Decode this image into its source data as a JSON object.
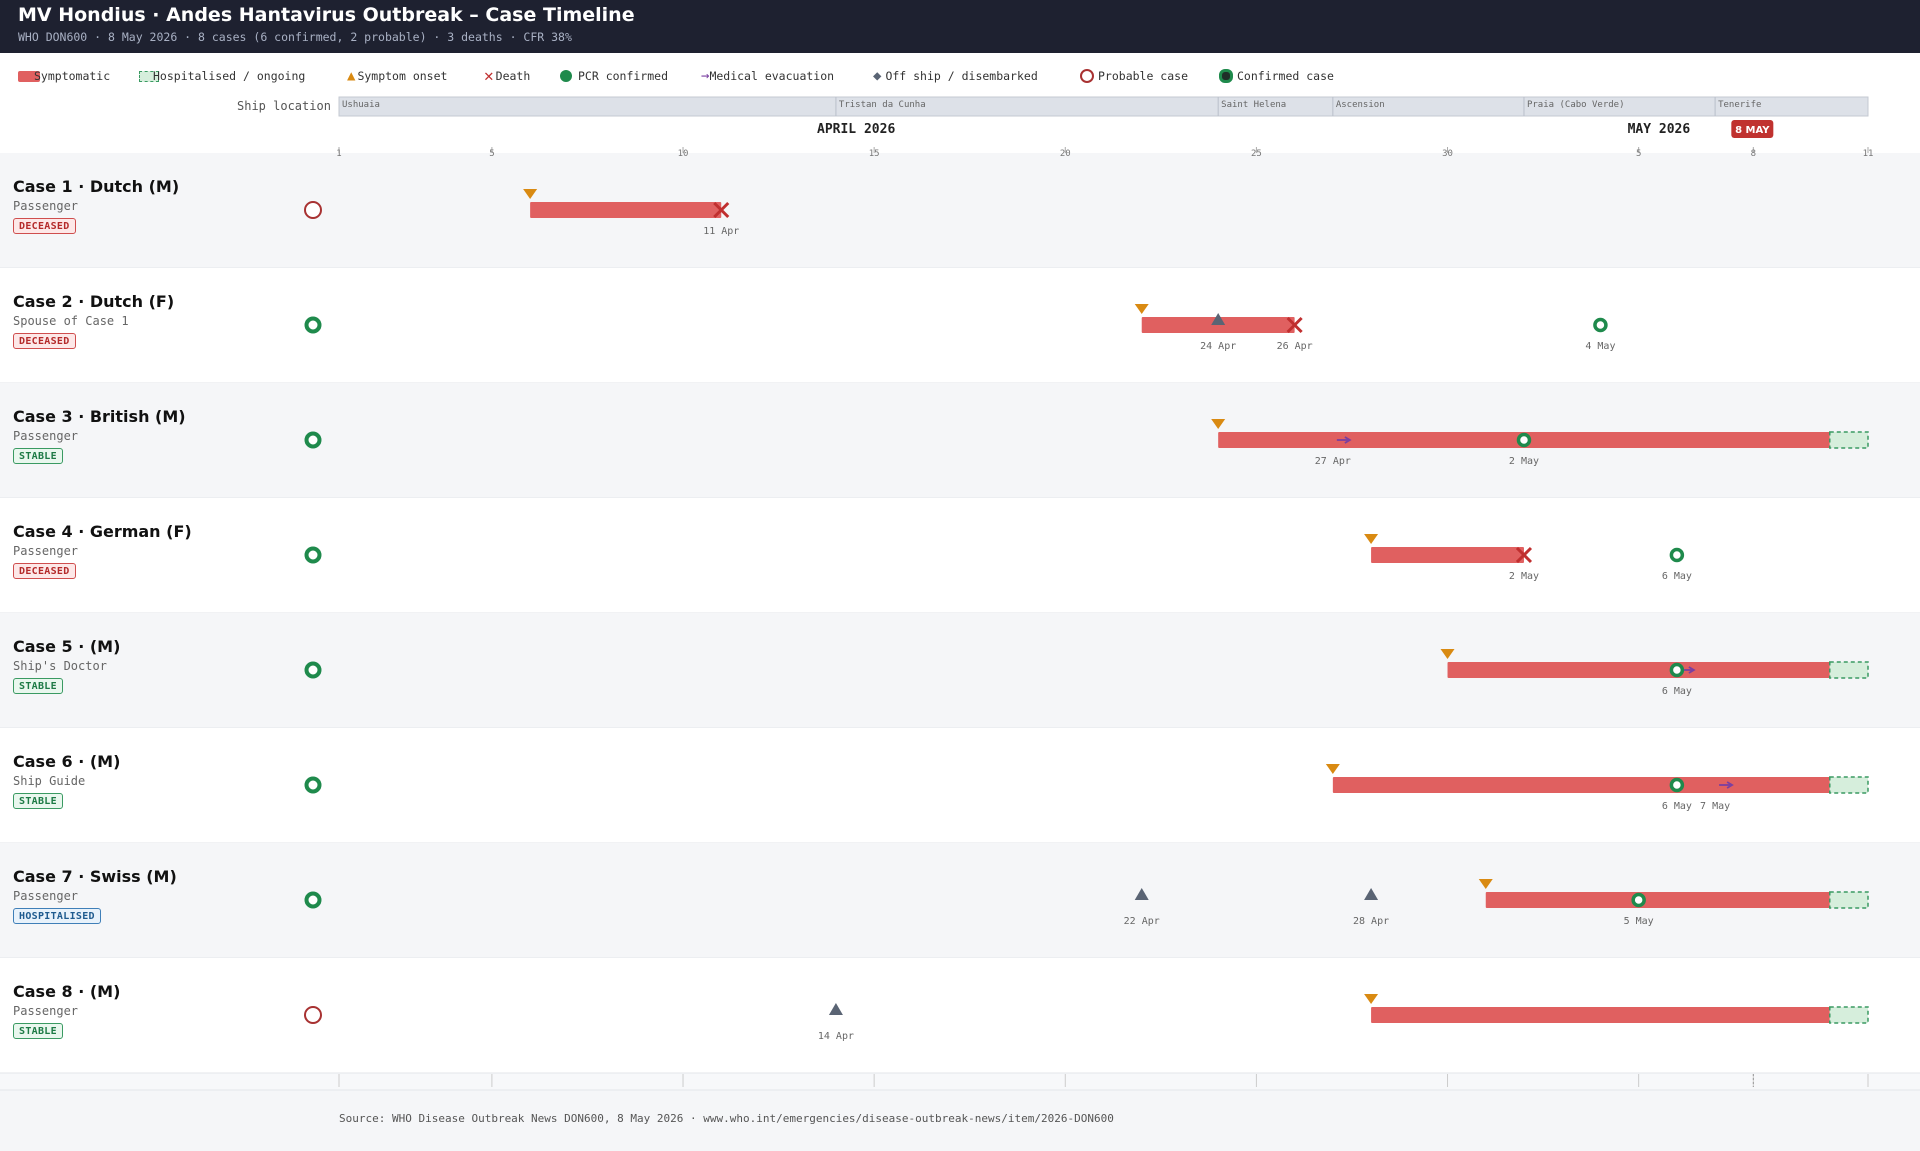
{
  "header": {
    "title": "MV Hondius · Andes Hantavirus Outbreak – Case Timeline",
    "subtitle": "WHO DON600 · 8 May 2026 · 8 cases (6 confirmed, 2 probable) · 3 deaths · CFR 38%"
  },
  "legend": [
    {
      "key": "symptomatic",
      "label": "Symptomatic",
      "color": "#e06060"
    },
    {
      "key": "hospitalised",
      "label": "Hospitalised / ongoing",
      "color": "#d6eedc"
    },
    {
      "key": "onset",
      "label": "Symptom onset",
      "color": "#d98a12"
    },
    {
      "key": "death",
      "label": "Death",
      "color": "#c02f2f"
    },
    {
      "key": "pcr",
      "label": "PCR confirmed",
      "color": "#1f8a4c"
    },
    {
      "key": "medevac",
      "label": "Medical evacuation",
      "color": "#7a3fa0"
    },
    {
      "key": "offship",
      "label": "Off ship / disembarked",
      "color": "#5a6474"
    },
    {
      "key": "probable",
      "label": "Probable case",
      "color": "#a83232"
    },
    {
      "key": "confirmed",
      "label": "Confirmed case",
      "color": "#1f8a4c"
    }
  ],
  "ship_location_label": "Ship location",
  "ship_locations": [
    {
      "name": "Ushuaia",
      "start": "2026-04-01"
    },
    {
      "name": "Tristan da Cunha",
      "start": "2026-04-14"
    },
    {
      "name": "Saint Helena",
      "start": "2026-04-24"
    },
    {
      "name": "Ascension",
      "start": "2026-04-27"
    },
    {
      "name": "Praia (Cabo Verde)",
      "start": "2026-05-02"
    },
    {
      "name": "Tenerife",
      "start": "2026-05-07"
    }
  ],
  "month_labels": [
    {
      "label": "APRIL 2026",
      "date": "2026-04-15"
    },
    {
      "label": "MAY 2026",
      "date": "2026-05-06"
    }
  ],
  "today_label": "8 MAY",
  "source": "Source: WHO Disease Outbreak News DON600, 8 May 2026 · www.who.int/emergencies/disease-outbreak-news/item/2026-DON600",
  "chart_data": {
    "type": "timeline",
    "x_range": [
      "2026-04-01",
      "2026-05-11"
    ],
    "ticks": [
      {
        "date": "2026-04-01",
        "label": "1"
      },
      {
        "date": "2026-04-05",
        "label": "5"
      },
      {
        "date": "2026-04-10",
        "label": "10"
      },
      {
        "date": "2026-04-15",
        "label": "15"
      },
      {
        "date": "2026-04-20",
        "label": "20"
      },
      {
        "date": "2026-04-25",
        "label": "25"
      },
      {
        "date": "2026-04-30",
        "label": "30"
      },
      {
        "date": "2026-05-05",
        "label": "5"
      },
      {
        "date": "2026-05-08",
        "label": "8"
      },
      {
        "date": "2026-05-11",
        "label": "11"
      }
    ],
    "today": "2026-05-08",
    "cases": [
      {
        "title": "Case 1 · Dutch (M)",
        "role": "Passenger",
        "status": "DECEASED",
        "classification": "probable",
        "symptomatic": [
          "2026-04-06",
          "2026-04-11"
        ],
        "ongoing": false,
        "onset": "2026-04-06",
        "death": "2026-04-11",
        "pcr": null,
        "offship": [],
        "medevac": [],
        "labels": [
          {
            "date": "2026-04-11",
            "text": "11 Apr"
          }
        ]
      },
      {
        "title": "Case 2 · Dutch (F)",
        "role": "Spouse of Case 1",
        "status": "DECEASED",
        "classification": "confirmed",
        "symptomatic": [
          "2026-04-22",
          "2026-04-26"
        ],
        "ongoing": false,
        "onset": "2026-04-22",
        "death": "2026-04-26",
        "pcr": "2026-05-04",
        "offship": [
          "2026-04-24"
        ],
        "medevac": [],
        "labels": [
          {
            "date": "2026-04-24",
            "text": "24 Apr"
          },
          {
            "date": "2026-04-26",
            "text": "26 Apr"
          },
          {
            "date": "2026-05-04",
            "text": "4 May"
          }
        ]
      },
      {
        "title": "Case 3 · British (M)",
        "role": "Passenger",
        "status": "STABLE",
        "classification": "confirmed",
        "symptomatic": [
          "2026-04-24",
          "2026-05-10"
        ],
        "ongoing": true,
        "onset": "2026-04-24",
        "death": null,
        "pcr": "2026-05-02",
        "offship": [],
        "medevac": [
          "2026-04-27"
        ],
        "labels": [
          {
            "date": "2026-04-27",
            "text": "27 Apr"
          },
          {
            "date": "2026-05-02",
            "text": "2 May"
          }
        ]
      },
      {
        "title": "Case 4 · German (F)",
        "role": "Passenger",
        "status": "DECEASED",
        "classification": "confirmed",
        "symptomatic": [
          "2026-04-28",
          "2026-05-02"
        ],
        "ongoing": false,
        "onset": "2026-04-28",
        "death": "2026-05-02",
        "pcr": "2026-05-06",
        "offship": [],
        "medevac": [],
        "labels": [
          {
            "date": "2026-05-02",
            "text": "2 May"
          },
          {
            "date": "2026-05-06",
            "text": "6 May"
          }
        ]
      },
      {
        "title": "Case 5 · (M)",
        "role": "Ship's Doctor",
        "status": "STABLE",
        "classification": "confirmed",
        "symptomatic": [
          "2026-04-30",
          "2026-05-10"
        ],
        "ongoing": true,
        "onset": "2026-04-30",
        "death": null,
        "pcr": "2026-05-06",
        "offship": [],
        "medevac": [
          "2026-05-06"
        ],
        "labels": [
          {
            "date": "2026-05-06",
            "text": "6 May"
          }
        ]
      },
      {
        "title": "Case 6 · (M)",
        "role": "Ship Guide",
        "status": "STABLE",
        "classification": "confirmed",
        "symptomatic": [
          "2026-04-27",
          "2026-05-10"
        ],
        "ongoing": true,
        "onset": "2026-04-27",
        "death": null,
        "pcr": "2026-05-06",
        "offship": [],
        "medevac": [
          "2026-05-07"
        ],
        "labels": [
          {
            "date": "2026-05-06",
            "text": "6 May"
          },
          {
            "date": "2026-05-07",
            "text": "7 May"
          }
        ]
      },
      {
        "title": "Case 7 · Swiss (M)",
        "role": "Passenger",
        "status": "HOSPITALISED",
        "classification": "confirmed",
        "symptomatic": [
          "2026-05-01",
          "2026-05-10"
        ],
        "ongoing": true,
        "onset": "2026-05-01",
        "death": null,
        "pcr": "2026-05-05",
        "offship": [
          "2026-04-22",
          "2026-04-28"
        ],
        "medevac": [],
        "labels": [
          {
            "date": "2026-04-22",
            "text": "22 Apr"
          },
          {
            "date": "2026-04-28",
            "text": "28 Apr"
          },
          {
            "date": "2026-05-05",
            "text": "5 May"
          }
        ]
      },
      {
        "title": "Case 8 · (M)",
        "role": "Passenger",
        "status": "STABLE",
        "classification": "probable",
        "symptomatic": [
          "2026-04-28",
          "2026-05-10"
        ],
        "ongoing": true,
        "onset": "2026-04-28",
        "death": null,
        "pcr": null,
        "offship": [
          "2026-04-14"
        ],
        "medevac": [],
        "labels": [
          {
            "date": "2026-04-14",
            "text": "14 Apr"
          }
        ]
      }
    ]
  }
}
